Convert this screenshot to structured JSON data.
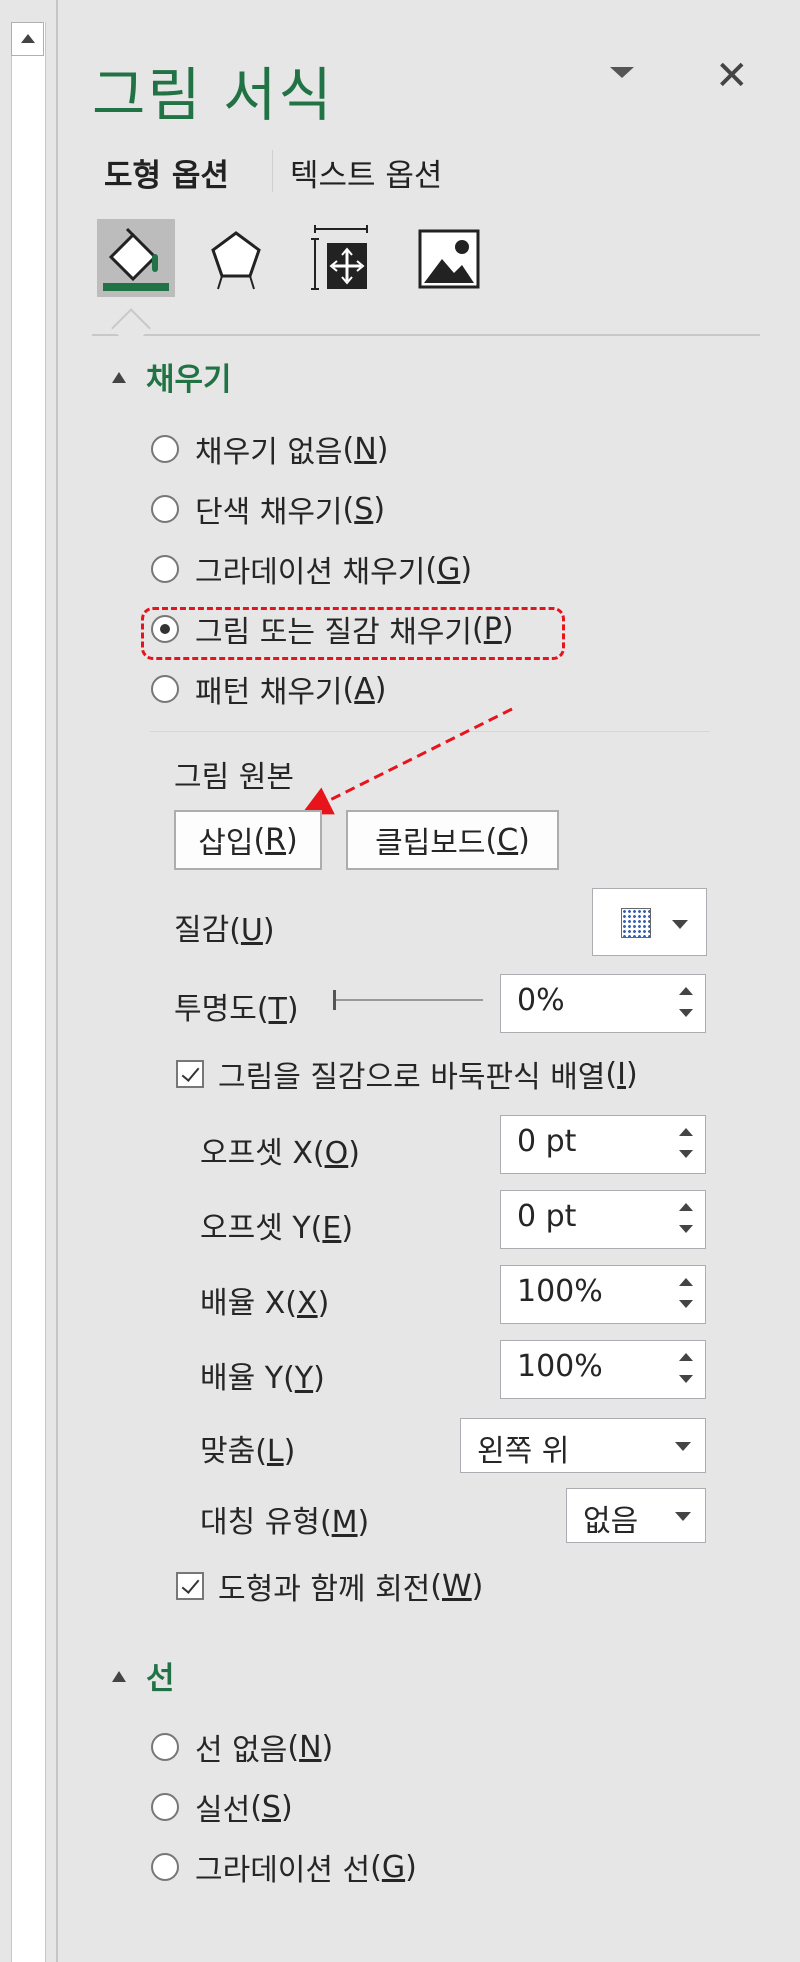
{
  "pane": {
    "title": "그림 서식",
    "tabs": {
      "shape_options": "도형 옵션",
      "text_options": "텍스트 옵션"
    },
    "icons": [
      "fill-line-icon",
      "effects-pentagon-icon",
      "size-properties-icon",
      "picture-icon"
    ]
  },
  "fill": {
    "header": "채우기",
    "options": [
      {
        "label": "채우기 없음",
        "key": "N",
        "selected": false
      },
      {
        "label": "단색 채우기",
        "key": "S",
        "selected": false
      },
      {
        "label": "그라데이션 채우기",
        "key": "G",
        "selected": false
      },
      {
        "label": "그림 또는 질감 채우기",
        "key": "P",
        "selected": true
      },
      {
        "label": "패턴 채우기",
        "key": "A",
        "selected": false
      }
    ],
    "picture_source_label": "그림 원본",
    "insert_button": {
      "text": "삽입",
      "key": "R"
    },
    "clipboard_button": {
      "text": "클립보드",
      "key": "C"
    },
    "texture_label": {
      "text": "질감",
      "key": "U"
    },
    "transparency_label": {
      "text": "투명도",
      "key": "T"
    },
    "transparency_value": "0%",
    "tile_checkbox": {
      "text": "그림을 질감으로 바둑판식 배열",
      "key": "I",
      "checked": true
    },
    "offset_x": {
      "label": "오프셋 X",
      "key": "O",
      "value": "0 pt"
    },
    "offset_y": {
      "label": "오프셋 Y",
      "key": "E",
      "value": "0 pt"
    },
    "scale_x": {
      "label": "배율 X",
      "key": "X",
      "value": "100%"
    },
    "scale_y": {
      "label": "배율 Y",
      "key": "Y",
      "value": "100%"
    },
    "alignment": {
      "label": "맞춤",
      "key": "L",
      "value": "왼쪽 위"
    },
    "mirror": {
      "label": "대칭 유형",
      "key": "M",
      "value": "없음"
    },
    "rotate_checkbox": {
      "text": "도형과 함께 회전",
      "key": "W",
      "checked": true
    }
  },
  "line": {
    "header": "선",
    "options": [
      {
        "label": "선 없음",
        "key": "N",
        "selected": false
      },
      {
        "label": "실선",
        "key": "S",
        "selected": false
      },
      {
        "label": "그라데이션 선",
        "key": "G",
        "selected": false
      }
    ]
  },
  "colors": {
    "accent_green": "#217346",
    "highlight_red": "#e8141b",
    "pane_bg": "#e6e6e6"
  }
}
